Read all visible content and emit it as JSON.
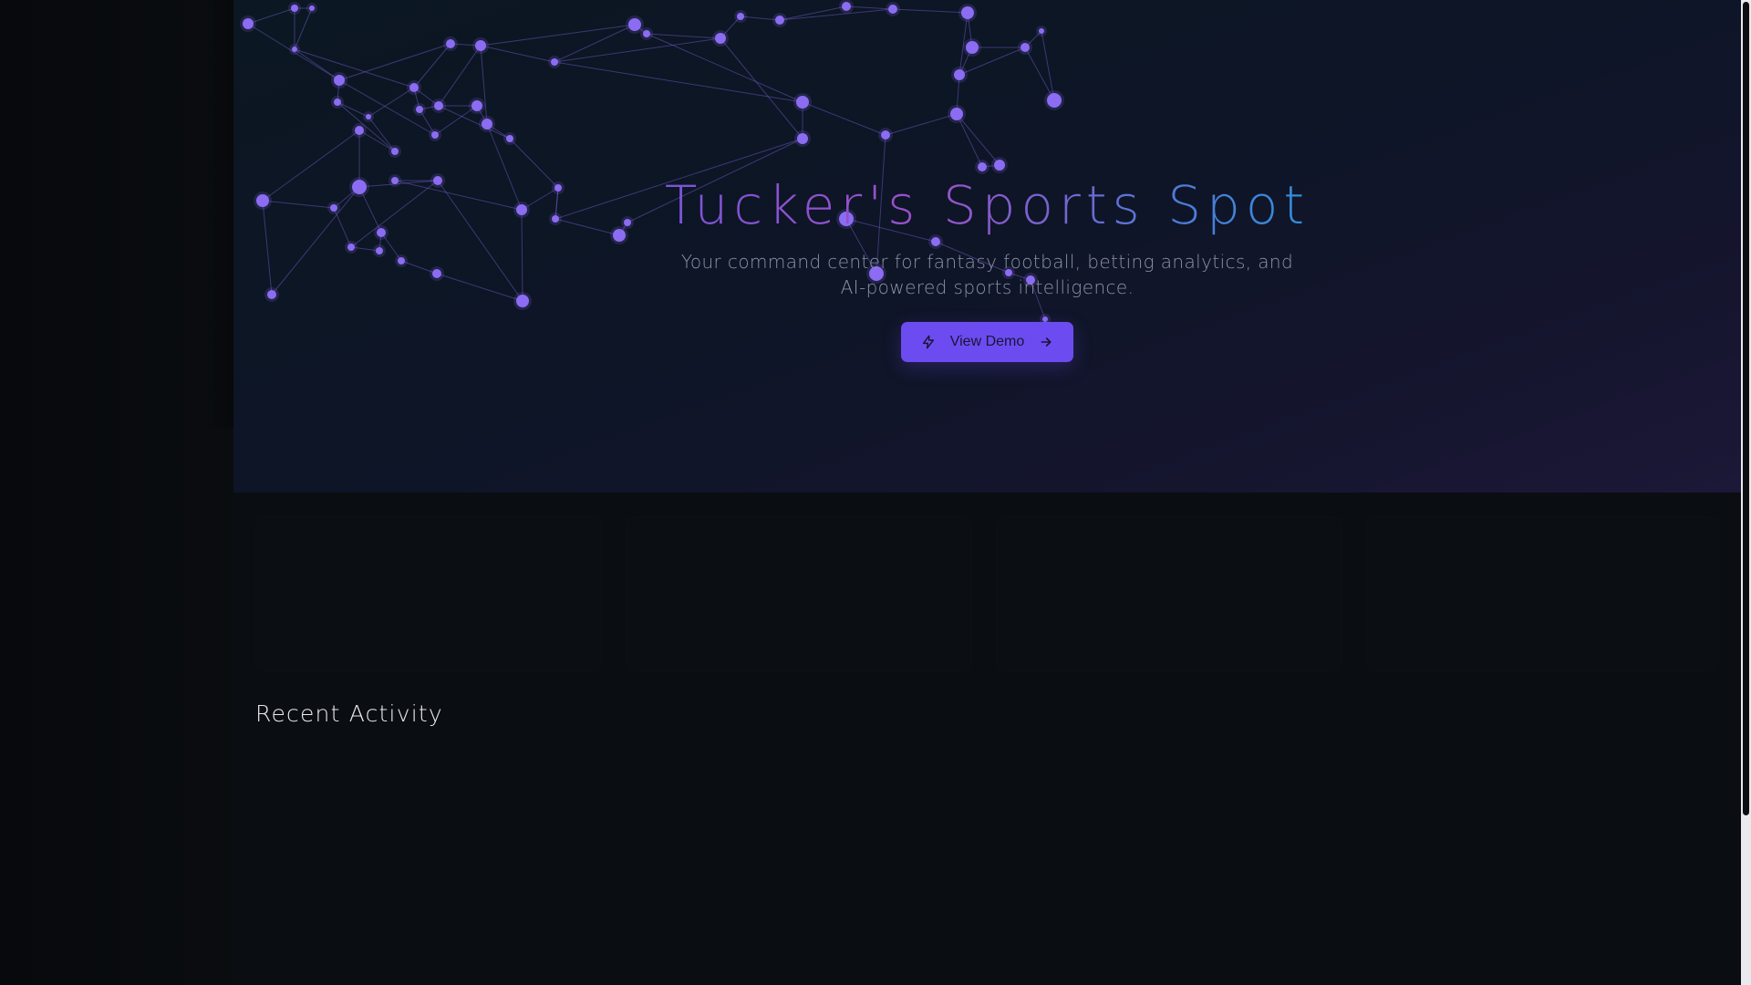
{
  "hero": {
    "title": "Tucker's Sports Spot",
    "subtitle": "Your command center for fantasy football, betting analytics, and AI-powered sports intelligence.",
    "cta_label": "View Demo",
    "cta_left_icon": "lightning-icon",
    "cta_right_icon": "arrow-right-icon"
  },
  "recent_activity": {
    "title": "Recent Activity"
  },
  "colors": {
    "accent": "#6c4cf0",
    "node": "#8b6cf2",
    "background": "#0a0d12"
  }
}
